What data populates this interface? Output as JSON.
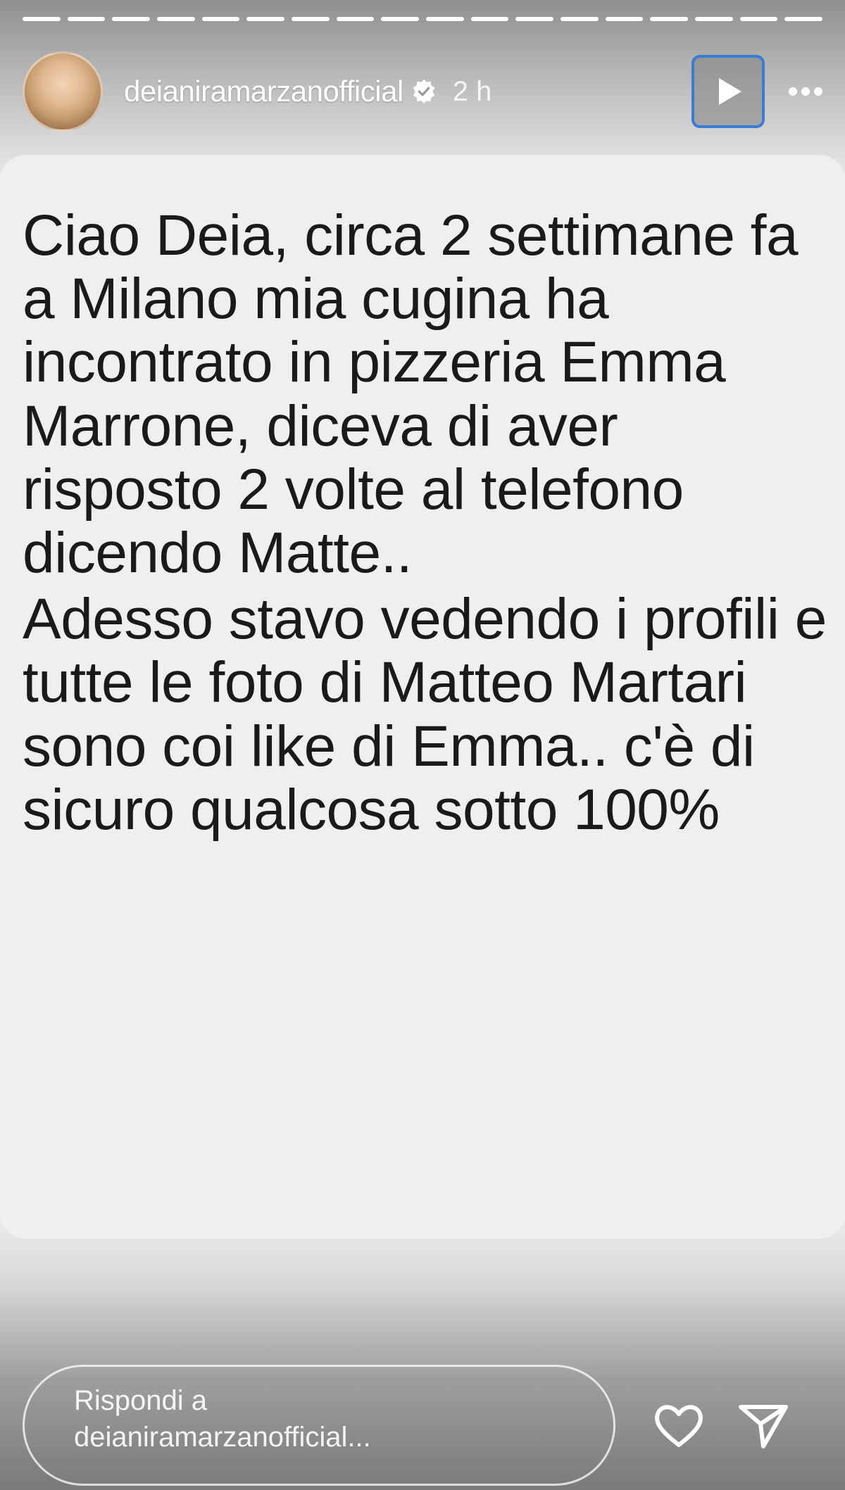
{
  "story": {
    "progress_segments_total": 18,
    "progress_segments_filled": 18
  },
  "header": {
    "username": "deianiramarzanofficial",
    "verified": true,
    "time": "2 h",
    "icons": {
      "play": "play-icon",
      "more": "more-options-icon",
      "verified": "verified-badge-icon"
    }
  },
  "message": {
    "paragraphs": [
      "Ciao Deia, circa 2 settimane fa a Milano mia cugina ha incontrato in pizzeria Emma Marrone, diceva di aver risposto 2 volte al telefono dicendo Matte..",
      "Adesso stavo vedendo i profili e tutte le foto di Matteo Martari sono coi like di Emma.. c'è di sicuro qualcosa sotto 100%"
    ]
  },
  "footer": {
    "reply_placeholder_line1": "Rispondi a",
    "reply_placeholder_line2": "deianiramarzanofficial...",
    "icons": {
      "like": "heart-icon",
      "share": "send-icon"
    }
  },
  "colors": {
    "accent_focus": "#3a7bd5",
    "text": "#1a1a1a",
    "card": "#efefef"
  }
}
